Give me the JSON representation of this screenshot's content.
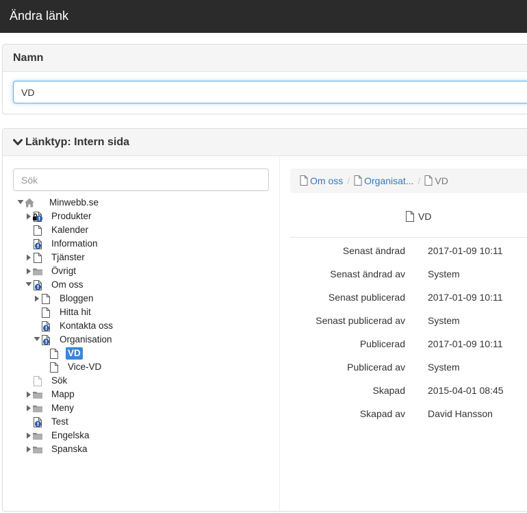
{
  "window": {
    "title": "Ändra länk"
  },
  "name_panel": {
    "heading": "Namn",
    "value": "VD"
  },
  "link_panel": {
    "heading": "Länktyp: Intern sida"
  },
  "search": {
    "placeholder": "Sök"
  },
  "tree": [
    {
      "label": "Minwebb.se",
      "depth": 0,
      "icon": "home-icon",
      "toggle": "open"
    },
    {
      "label": "Produkter",
      "depth": 1,
      "icon": "locked-info-page-icon",
      "toggle": "closed"
    },
    {
      "label": "Kalender",
      "depth": 1,
      "icon": "page-icon",
      "toggle": "none"
    },
    {
      "label": "Information",
      "depth": 1,
      "icon": "info-page-icon",
      "toggle": "none"
    },
    {
      "label": "Tjänster",
      "depth": 1,
      "icon": "page-icon",
      "toggle": "closed"
    },
    {
      "label": "Övrigt",
      "depth": 1,
      "icon": "folder-icon",
      "toggle": "closed"
    },
    {
      "label": "Om oss",
      "depth": 1,
      "icon": "info-page-icon",
      "toggle": "open"
    },
    {
      "label": "Bloggen",
      "depth": 2,
      "icon": "page-icon",
      "toggle": "closed"
    },
    {
      "label": "Hitta hit",
      "depth": 2,
      "icon": "page-icon",
      "toggle": "none"
    },
    {
      "label": "Kontakta oss",
      "depth": 2,
      "icon": "info-page-icon",
      "toggle": "none"
    },
    {
      "label": "Organisation",
      "depth": 2,
      "icon": "info-page-icon",
      "toggle": "open"
    },
    {
      "label": "VD",
      "depth": 3,
      "icon": "page-icon",
      "toggle": "none",
      "selected": true
    },
    {
      "label": "Vice-VD",
      "depth": 3,
      "icon": "page-icon",
      "toggle": "none"
    },
    {
      "label": "Sök",
      "depth": 1,
      "icon": "faded-page-icon",
      "toggle": "none"
    },
    {
      "label": "Mapp",
      "depth": 1,
      "icon": "folder-icon",
      "toggle": "closed"
    },
    {
      "label": "Meny",
      "depth": 1,
      "icon": "folder-icon",
      "toggle": "closed"
    },
    {
      "label": "Test",
      "depth": 1,
      "icon": "info-page-icon",
      "toggle": "none"
    },
    {
      "label": "Engelska",
      "depth": 1,
      "icon": "folder-icon",
      "toggle": "closed"
    },
    {
      "label": "Spanska",
      "depth": 1,
      "icon": "folder-icon",
      "toggle": "closed"
    }
  ],
  "breadcrumb": {
    "items": [
      "Om oss",
      "Organisat..."
    ],
    "current": "VD",
    "separator": "/"
  },
  "page": {
    "title": "VD"
  },
  "properties": [
    {
      "label": "Senast ändrad",
      "value": "2017-01-09 10:11"
    },
    {
      "label": "Senast ändrad av",
      "value": "System"
    },
    {
      "label": "Senast publicerad",
      "value": "2017-01-09 10:11"
    },
    {
      "label": "Senast publicerad av",
      "value": "System"
    },
    {
      "label": "Publicerad",
      "value": "2017-01-09 10:11"
    },
    {
      "label": "Publicerad av",
      "value": "System"
    },
    {
      "label": "Skapad",
      "value": "2015-04-01 08:45"
    },
    {
      "label": "Skapad av",
      "value": "David Hansson"
    }
  ],
  "colors": {
    "titlebar": "#2b2b2b",
    "link": "#337ab7",
    "selected": "#3a87d6",
    "info_badge": "#2a5ba8"
  }
}
